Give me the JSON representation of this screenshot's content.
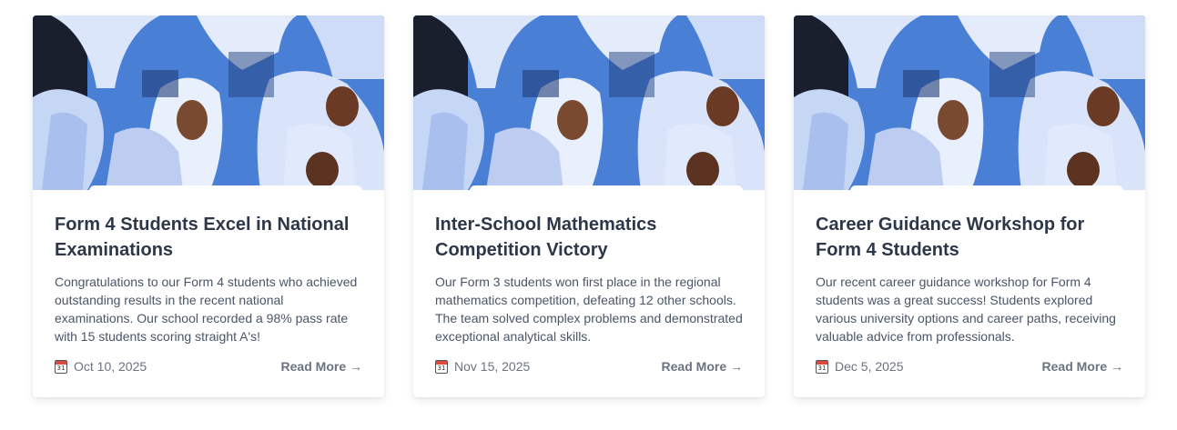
{
  "colors": {
    "title": "#2d3748",
    "text": "#4a5568",
    "muted": "#6b7280",
    "card_background": "#ffffff"
  },
  "cards": [
    {
      "image_alt": "students in white hijabs",
      "title": "Form 4 Students Excel in National Examinations",
      "excerpt": "Congratulations to our Form 4 students who achieved outstanding results in the recent national examinations. Our school recorded a 98% pass rate with 15 students scoring straight A's!",
      "date": "Oct 10, 2025",
      "date_icon": "calendar-icon",
      "calendar_day": "31",
      "read_more": "Read More →"
    },
    {
      "image_alt": "students in white hijabs",
      "title": "Inter-School Mathematics Competition Victory",
      "excerpt": "Our Form 3 students won first place in the regional mathematics competition, defeating 12 other schools. The team solved complex problems and demonstrated exceptional analytical skills.",
      "date": "Nov 15, 2025",
      "date_icon": "calendar-icon",
      "calendar_day": "31",
      "read_more": "Read More →"
    },
    {
      "image_alt": "students in white hijabs",
      "title": "Career Guidance Workshop for Form 4 Students",
      "excerpt": "Our recent career guidance workshop for Form 4 students was a great success! Students explored various university options and career paths, receiving valuable advice from professionals.",
      "date": "Dec 5, 2025",
      "date_icon": "calendar-icon",
      "calendar_day": "31",
      "read_more": "Read More →"
    }
  ]
}
